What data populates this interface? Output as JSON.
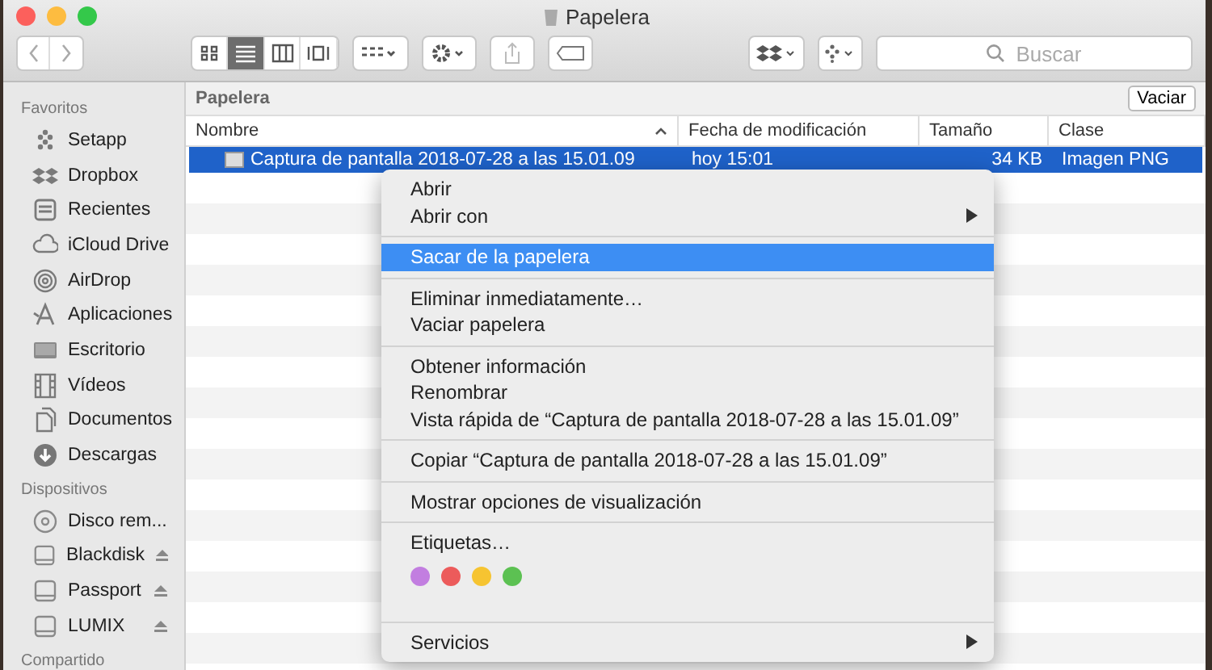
{
  "window": {
    "title": "Papelera"
  },
  "toolbar": {
    "view_modes": [
      {
        "selected": false
      },
      {
        "selected": true
      },
      {
        "selected": false
      },
      {
        "selected": false
      }
    ],
    "search": {
      "placeholder": "Buscar"
    }
  },
  "sidebar": {
    "sections": [
      {
        "title": "Favoritos",
        "items": [
          {
            "label": "Setapp",
            "eject": false
          },
          {
            "label": "Dropbox",
            "eject": false
          },
          {
            "label": "Recientes",
            "eject": false
          },
          {
            "label": "iCloud Drive",
            "eject": false
          },
          {
            "label": "AirDrop",
            "eject": false
          },
          {
            "label": "Aplicaciones",
            "eject": false
          },
          {
            "label": "Escritorio",
            "eject": false
          },
          {
            "label": "Vídeos",
            "eject": false
          },
          {
            "label": "Documentos",
            "eject": false
          },
          {
            "label": "Descargas",
            "eject": false
          }
        ]
      },
      {
        "title": "Dispositivos",
        "items": [
          {
            "label": "Disco rem...",
            "eject": false
          },
          {
            "label": "Blackdisk",
            "eject": true
          },
          {
            "label": "Passport",
            "eject": true
          },
          {
            "label": "LUMIX",
            "eject": true
          }
        ]
      },
      {
        "title": "Compartido"
      }
    ]
  },
  "path_bar": {
    "title": "Papelera",
    "button": "Vaciar"
  },
  "table": {
    "columns": [
      {
        "label": "Nombre",
        "sorted": true
      },
      {
        "label": "Fecha de modificación",
        "sorted": false
      },
      {
        "label": "Tamaño",
        "sorted": false
      },
      {
        "label": "Clase",
        "sorted": false
      }
    ],
    "rows": [
      {
        "name": "Captura de pantalla 2018-07-28 a las 15.01.09",
        "date": "hoy 15:01",
        "size": "34 KB",
        "kind": "Imagen PNG",
        "selected": true
      }
    ]
  },
  "context_menu": {
    "items": [
      {
        "kind": "item",
        "label": "Abrir",
        "submenu": false,
        "selected": false
      },
      {
        "kind": "item",
        "label": "Abrir con",
        "submenu": true,
        "selected": false
      },
      {
        "kind": "separator"
      },
      {
        "kind": "item",
        "label": "Sacar de la papelera",
        "submenu": false,
        "selected": true
      },
      {
        "kind": "separator"
      },
      {
        "kind": "item",
        "label": "Eliminar inmediatamente…",
        "submenu": false,
        "selected": false
      },
      {
        "kind": "item",
        "label": "Vaciar papelera",
        "submenu": false,
        "selected": false
      },
      {
        "kind": "separator"
      },
      {
        "kind": "item",
        "label": "Obtener información",
        "submenu": false,
        "selected": false
      },
      {
        "kind": "item",
        "label": "Renombrar",
        "submenu": false,
        "selected": false
      },
      {
        "kind": "item",
        "label": "Vista rápida de “Captura de pantalla 2018-07-28 a las 15.01.09”",
        "submenu": false,
        "selected": false
      },
      {
        "kind": "separator"
      },
      {
        "kind": "item",
        "label": "Copiar “Captura de pantalla 2018-07-28 a las 15.01.09”",
        "submenu": false,
        "selected": false
      },
      {
        "kind": "separator"
      },
      {
        "kind": "item",
        "label": "Mostrar opciones de visualización",
        "submenu": false,
        "selected": false
      },
      {
        "kind": "separator"
      },
      {
        "kind": "item",
        "label": "Etiquetas…",
        "submenu": false,
        "selected": false
      },
      {
        "kind": "tags",
        "tags": [
          {
            "color": "#c27ee0"
          },
          {
            "color": "#ec5b5b"
          },
          {
            "color": "#f6c431"
          },
          {
            "color": "#5cc152"
          }
        ]
      },
      {
        "kind": "separator"
      },
      {
        "kind": "item",
        "label": "Servicios",
        "submenu": true,
        "selected": false
      }
    ]
  }
}
